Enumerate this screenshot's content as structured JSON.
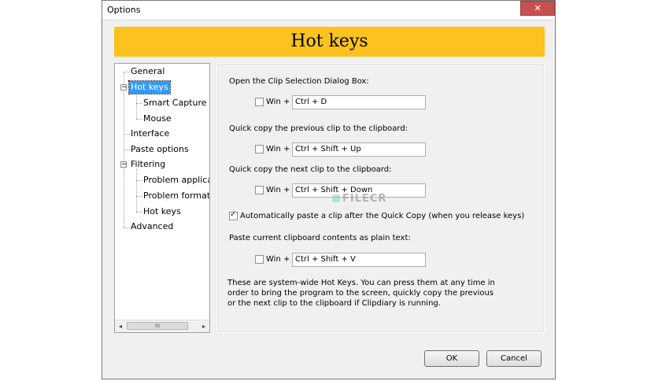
{
  "window": {
    "title": "Options",
    "close_glyph": "✕"
  },
  "banner": {
    "title": "Hot keys"
  },
  "tree": {
    "items": [
      {
        "label": "General"
      },
      {
        "label": "Hot keys",
        "expander": "−"
      },
      {
        "label": "Smart Capture"
      },
      {
        "label": "Mouse"
      },
      {
        "label": "Interface"
      },
      {
        "label": "Paste options"
      },
      {
        "label": "Filtering",
        "expander": "−"
      },
      {
        "label": "Problem applications"
      },
      {
        "label": "Problem formats"
      },
      {
        "label": "Hot keys"
      },
      {
        "label": "Advanced"
      }
    ],
    "scroll_left": "◂",
    "scroll_right": "▸",
    "scroll_grip": "III"
  },
  "panel": {
    "sections": [
      {
        "label": "Open the Clip Selection Dialog Box:",
        "win_label": "Win +",
        "value": "Ctrl + D"
      },
      {
        "label": "Quick copy the previous clip to the clipboard:",
        "win_label": "Win +",
        "value": "Ctrl + Shift + Up"
      },
      {
        "label": "Quick copy the next clip to the clipboard:",
        "win_label": "Win +",
        "value": "Ctrl + Shift + Down"
      },
      {
        "label": "Paste current clipboard contents as plain text:",
        "win_label": "Win +",
        "value": "Ctrl + Shift + V"
      }
    ],
    "auto_paste_label": "Automatically paste a clip after the Quick Copy (when you release keys)",
    "note": "These are system-wide Hot Keys. You can press them at any time in order to bring the program to the screen, quickly copy the previous or the next clip to the clipboard if Clipdiary is running."
  },
  "buttons": {
    "ok": "OK",
    "cancel": "Cancel"
  },
  "watermark": {
    "text": "FILECR"
  }
}
